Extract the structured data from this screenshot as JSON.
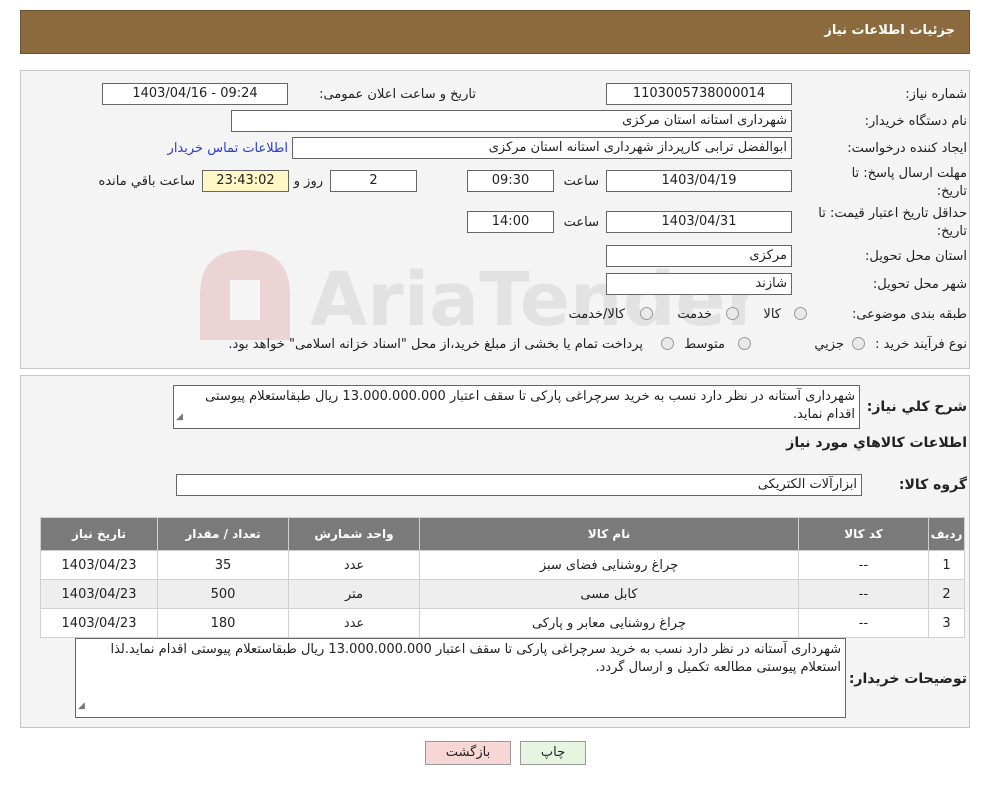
{
  "header": {
    "title": "جزئیات اطلاعات نیاز"
  },
  "form": {
    "need_number_label": "شماره نیاز:",
    "need_number": "1103005738000014",
    "announce_label": "تاریخ و ساعت اعلان عمومی:",
    "announce_value": "1403/04/16 - 09:24",
    "buyer_org_label": "نام دستگاه خریدار:",
    "buyer_org": "شهرداری استانه استان مرکزی",
    "requester_label": "ایجاد کننده درخواست:",
    "requester": "ابوالفضل  ترابی  کارپرداز  شهرداری استانه استان مرکزی",
    "contact_link": "اطلاعات تماس خریدار",
    "deadline_label_1": "مهلت ارسال پاسخ: تا",
    "deadline_label_2": "تاریخ:",
    "deadline_date": "1403/04/19",
    "time_label": "ساعت",
    "deadline_time": "09:30",
    "days": "2",
    "days_label": "روز و",
    "remaining": "23:43:02",
    "remaining_label": "ساعت باقي مانده",
    "validity_label_1": "حداقل تاریخ اعتبار قیمت: تا",
    "validity_label_2": "تاریخ:",
    "validity_date": "1403/04/31",
    "validity_time": "14:00",
    "province_label": "استان محل تحویل:",
    "province": "مرکزی",
    "city_label": "شهر محل تحویل:",
    "city": "شازند",
    "category_label": "طبقه بندی موضوعی:",
    "category_options": [
      "کالا",
      "خدمت",
      "کالا/خدمت"
    ],
    "process_label": "نوع فرآیند خرید :",
    "process_options": [
      "جزیي",
      "متوسط"
    ],
    "process_note": "پرداخت تمام یا بخشی از مبلغ خرید،از محل \"اسناد خزانه اسلامی\" خواهد بود."
  },
  "watermark_text": "AriaTender.neT",
  "summary": {
    "label": "شرح کلي نیاز:",
    "text": "شهرداری آستانه در نظر دارد نسب به خرید سرچراغی پارکی تا سقف اعتبار 13.000.000.000 ریال طبقاستعلام پیوستی اقدام نماید."
  },
  "goods": {
    "section_title": "اطلاعات کالاهاي مورد نیاز",
    "group_label": "گروه کالا:",
    "group_value": "ابزارآلات الکتریکی",
    "columns": [
      "ردیف",
      "کد کالا",
      "نام کالا",
      "واحد شمارش",
      "تعداد / مقدار",
      "تاریخ نیاز"
    ],
    "rows": [
      [
        "1",
        "--",
        "چراغ روشنایی فضای سبز",
        "عدد",
        "35",
        "1403/04/23"
      ],
      [
        "2",
        "--",
        "کابل مسی",
        "متر",
        "500",
        "1403/04/23"
      ],
      [
        "3",
        "--",
        "چراغ روشنایی معابر و پارکی",
        "عدد",
        "180",
        "1403/04/23"
      ]
    ]
  },
  "buyer_notes": {
    "label": "توضیحات خریدار:",
    "text": "شهرداری آستانه در نظر دارد نسب به خرید سرچراغی پارکی تا سقف اعتبار 13.000.000.000 ریال طبقاستعلام پیوستی اقدام نماید.لذا استعلام پیوستی مطالعه  تکمیل و ارسال گردد."
  },
  "buttons": {
    "print": "چاپ",
    "back": "بازگشت"
  },
  "colors": {
    "title_bar": "#8b6b3d",
    "table_header": "#7a7a7a",
    "print_btn": "#e6f5df",
    "back_btn": "#f7d6d6"
  }
}
